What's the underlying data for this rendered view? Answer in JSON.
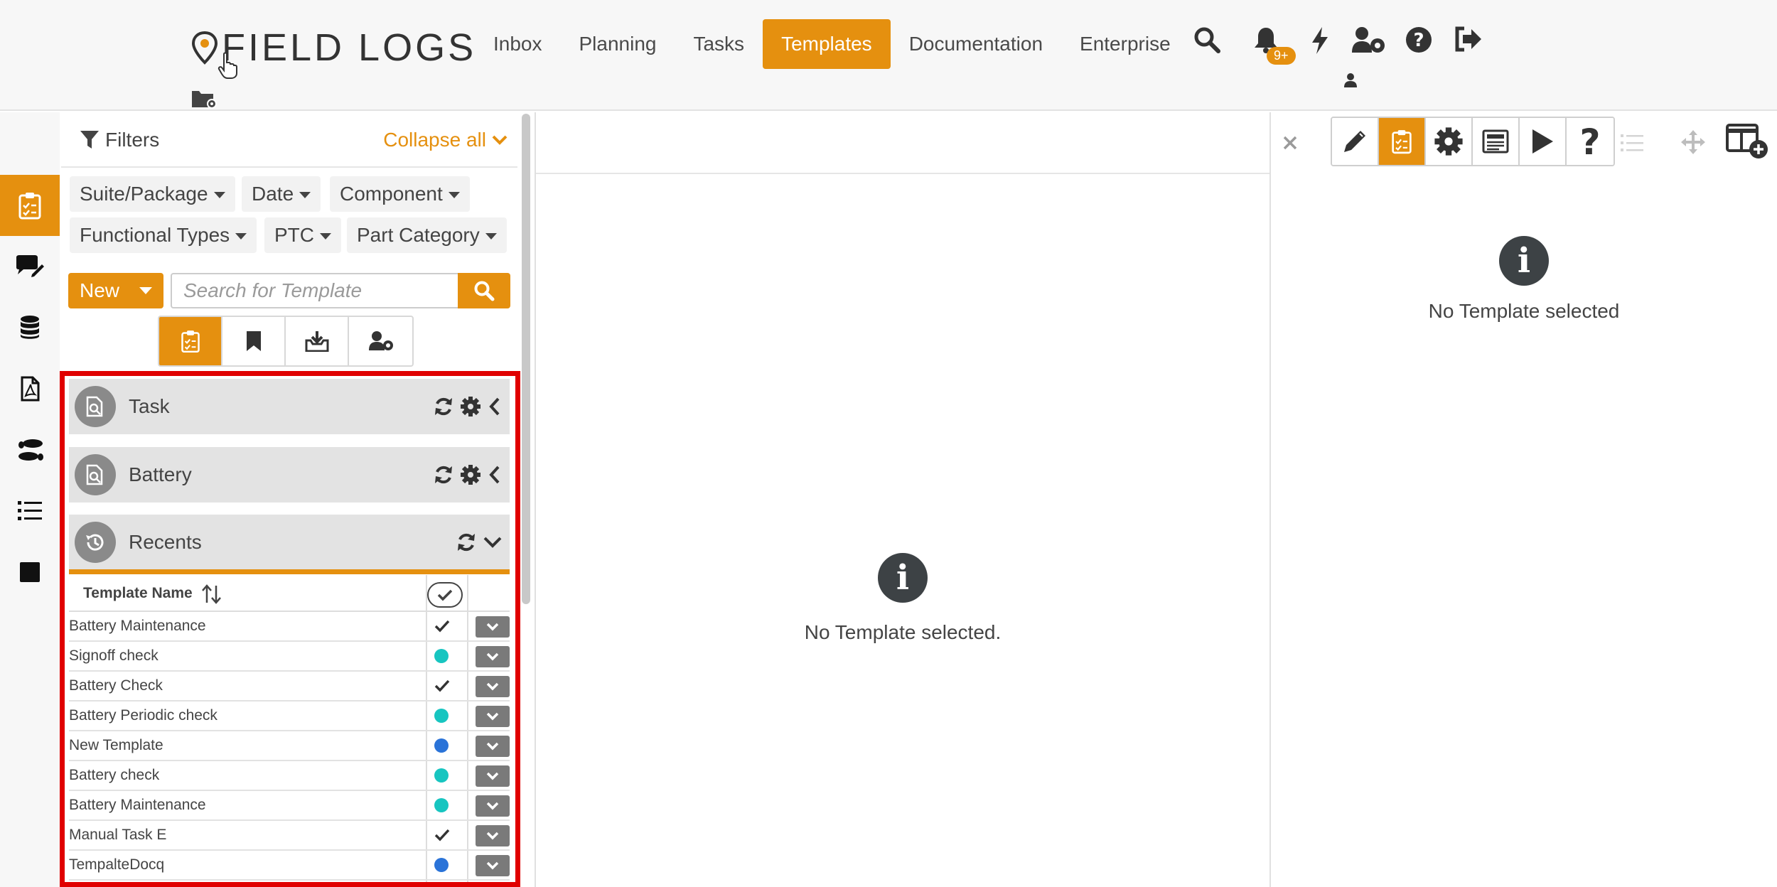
{
  "header": {
    "logo_text": "FIELD LOGS",
    "nav": [
      {
        "label": "Inbox"
      },
      {
        "label": "Planning"
      },
      {
        "label": "Tasks"
      },
      {
        "label": "Templates",
        "active": true
      },
      {
        "label": "Documentation"
      },
      {
        "label": "Enterprise"
      }
    ],
    "notification_badge": "9+",
    "icons": [
      "search-icon",
      "bell-icon",
      "bolt-icon",
      "users-gear-icon",
      "help-icon",
      "sign-out-icon"
    ]
  },
  "sidebar_rail": {
    "icons": [
      "clipboard-checklist-icon",
      "comment-edit-icon",
      "database-icon",
      "pdf-file-icon",
      "footprints-icon",
      "ordered-list-icon",
      "stop-square-icon"
    ],
    "active_index": 0
  },
  "filters": {
    "title": "Filters",
    "collapse_label": "Collapse all",
    "dropdowns": [
      "Suite/Package",
      "Date",
      "Component",
      "Functional Types",
      "PTC",
      "Part Category"
    ]
  },
  "toolbar": {
    "new_label": "New",
    "search_placeholder": "Search for Template",
    "view_tabs": [
      "clipboard-checklist-icon",
      "bookmark-icon",
      "inbox-download-icon",
      "user-gear-icon"
    ],
    "active_view": 0
  },
  "sections": [
    {
      "label": "Task",
      "icon": "file-search-icon",
      "expanded": false
    },
    {
      "label": "Battery",
      "icon": "file-search-icon",
      "expanded": false
    },
    {
      "label": "Recents",
      "icon": "history-icon",
      "expanded": true
    }
  ],
  "table": {
    "col_name": "Template Name",
    "rows": [
      {
        "name": "Battery Maintenance",
        "status": "check"
      },
      {
        "name": "Signoff check",
        "status": "teal"
      },
      {
        "name": "Battery Check",
        "status": "check"
      },
      {
        "name": "Battery Periodic check",
        "status": "teal"
      },
      {
        "name": "New Template",
        "status": "blue"
      },
      {
        "name": "Battery check",
        "status": "teal"
      },
      {
        "name": "Battery Maintenance",
        "status": "teal"
      },
      {
        "name": "Manual Task E",
        "status": "check"
      },
      {
        "name": "TempalteDocq",
        "status": "blue"
      }
    ],
    "status_colors": {
      "teal": "#17c5c0",
      "blue": "#2a73d8"
    }
  },
  "center": {
    "empty_text": "No Template selected."
  },
  "right_panel": {
    "toolbar_icons": [
      "pencil-icon",
      "clipboard-checklist-icon",
      "gear-icon",
      "newspaper-icon",
      "play-icon",
      "question-icon"
    ],
    "active_tool": 1,
    "empty_text": "No Template selected"
  },
  "colors": {
    "accent": "#e5900f",
    "highlight_frame": "#e00000"
  }
}
